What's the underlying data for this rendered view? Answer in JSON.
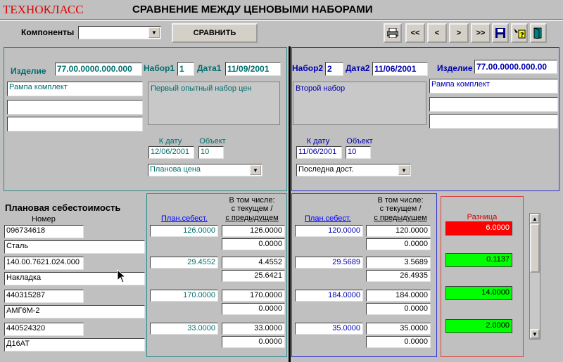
{
  "app": {
    "brand": "ТЕХНОКЛАСС",
    "title": "СРАВНЕНИЕ МЕЖДУ ЦЕНОВЫМИ НАБОРАМИ"
  },
  "toolbar": {
    "components_label": "Компоненты",
    "components_value": "",
    "compare_label": "СРАВНИТЬ",
    "first": "<<",
    "prev": "<",
    "next": ">",
    "last": ">>"
  },
  "set1": {
    "product_label": "Изделие",
    "product_value": "77.00.0000.000.000",
    "set_label": "Набор1",
    "set_value": "1",
    "date_label": "Дата1",
    "date_value": "11/09/2001",
    "desc1": "Рампа комплект",
    "desc2": "",
    "desc3": "",
    "set_desc": "Первый опытный набор цен",
    "to_date_label": "К дату",
    "to_date_value": "12/06/2001",
    "object_label": "Объект",
    "object_value": "10",
    "price_type": "Планова цена"
  },
  "set2": {
    "product_label": "Изделие",
    "product_value": "77.00.0000.000.00",
    "set_label": "Набор2",
    "set_value": "2",
    "date_label": "Дата2",
    "date_value": "11/06/2001",
    "desc1": "Рампа комплект",
    "desc2": "",
    "desc3": "",
    "set_desc": "Второй набор",
    "to_date_label": "К дату",
    "to_date_value": "11/06/2001",
    "object_label": "Объект",
    "object_value": "10",
    "price_type": "Последна дост."
  },
  "bottom": {
    "heading": "Плановая себестоимость",
    "number_label": "Номер",
    "plan_label": "План.себест.",
    "incl_label": "В том числе:",
    "incl_line2": "с текущем /",
    "incl_line3": "с предыдущем",
    "diff_label": "Разница"
  },
  "rows": [
    {
      "number": "096734618",
      "material": "Сталь",
      "plan1": "126.0000",
      "cur1": "126.0000",
      "prev1": "0.0000",
      "plan2": "120.0000",
      "cur2": "120.0000",
      "prev2": "0.0000",
      "diff": "6.0000",
      "diff_color": "#ff0000"
    },
    {
      "number": "140.00.7621.024.000",
      "material": "Накладка",
      "plan1": "29.4552",
      "cur1": "4.4552",
      "prev1": "25.6421",
      "plan2": "29.5689",
      "cur2": "3.5689",
      "prev2": "26.4935",
      "diff": "0.1137",
      "diff_color": "#00ff00"
    },
    {
      "number": "440315287",
      "material": "АМГ6М-2",
      "plan1": "170.0000",
      "cur1": "170.0000",
      "prev1": "0.0000",
      "plan2": "184.0000",
      "cur2": "184.0000",
      "prev2": "0.0000",
      "diff": "14.0000",
      "diff_color": "#00ff00"
    },
    {
      "number": "440524320",
      "material": "Д16АТ",
      "plan1": "33.0000",
      "cur1": "33.0000",
      "prev1": "0.0000",
      "plan2": "35.0000",
      "cur2": "35.0000",
      "prev2": "0.0000",
      "diff": "2.0000",
      "diff_color": "#00ff00"
    }
  ]
}
